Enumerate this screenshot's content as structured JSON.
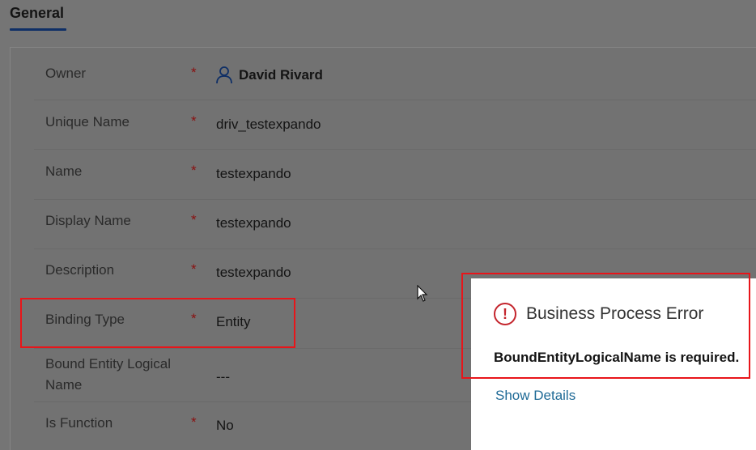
{
  "section": {
    "tab_label": "General"
  },
  "fields": {
    "owner": {
      "label": "Owner",
      "required": "*",
      "value": "David Rivard"
    },
    "unique_name": {
      "label": "Unique Name",
      "required": "*",
      "value": "driv_testexpando"
    },
    "name": {
      "label": "Name",
      "required": "*",
      "value": "testexpando"
    },
    "display_name": {
      "label": "Display Name",
      "required": "*",
      "value": "testexpando"
    },
    "description": {
      "label": "Description",
      "required": "*",
      "value": "testexpando"
    },
    "binding_type": {
      "label": "Binding Type",
      "required": "*",
      "value": "Entity"
    },
    "bound_entity_logical_name": {
      "label_line1": "Bound Entity Logical",
      "label_line2": "Name",
      "value": "---"
    },
    "is_function": {
      "label": "Is Function",
      "required": "*",
      "value": "No"
    }
  },
  "error_dialog": {
    "title": "Business Process Error",
    "icon": "error-circle-icon",
    "message": "BoundEntityLogicalName is required.",
    "show_details": "Show Details"
  },
  "colors": {
    "overlay": "#757575",
    "highlight": "#e8151a",
    "error_icon": "#c4262e",
    "link": "#1f6a96",
    "owner_link": "#0f2f66"
  }
}
